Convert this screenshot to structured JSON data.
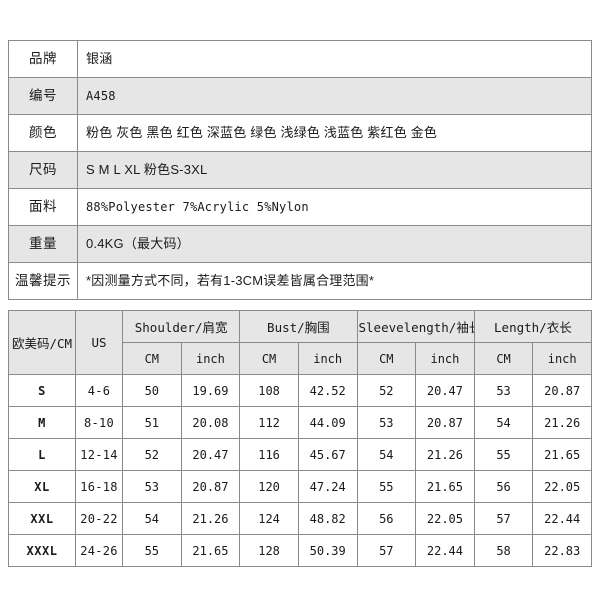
{
  "product_info": {
    "rows": [
      {
        "label": "品牌",
        "value": "银涵",
        "shaded": false,
        "mono": false
      },
      {
        "label": "编号",
        "value": "A458",
        "shaded": true,
        "mono": true
      },
      {
        "label": "颜色",
        "value": "粉色 灰色 黑色 红色 深蓝色 绿色 浅绿色 浅蓝色 紫红色 金色",
        "shaded": false,
        "mono": false
      },
      {
        "label": "尺码",
        "value": "S M L XL  粉色S-3XL",
        "shaded": true,
        "mono": false
      },
      {
        "label": "面料",
        "value": "88%Polyester  7%Acrylic  5%Nylon",
        "shaded": false,
        "mono": true
      },
      {
        "label": "重量",
        "value": "0.4KG（最大码）",
        "shaded": true,
        "mono": false
      },
      {
        "label": "温馨提示",
        "value": "*因测量方式不同，若有1-3CM误差皆属合理范围*",
        "shaded": false,
        "mono": false
      }
    ]
  },
  "size_chart": {
    "header_groups": [
      {
        "label": "欧美码/CM",
        "span": 1,
        "rowspan": 2
      },
      {
        "label": "US",
        "span": 1,
        "rowspan": 2
      },
      {
        "label": "Shoulder/肩宽",
        "span": 2,
        "rowspan": 1
      },
      {
        "label": "Bust/胸围",
        "span": 2,
        "rowspan": 1
      },
      {
        "label": "Sleevelength/袖长",
        "span": 2,
        "rowspan": 1
      },
      {
        "label": "Length/衣长",
        "span": 2,
        "rowspan": 1
      }
    ],
    "header_units": [
      "CM",
      "inch",
      "CM",
      "inch",
      "CM",
      "inch",
      "CM",
      "inch"
    ],
    "rows": [
      {
        "size": "S",
        "us": "4-6",
        "shoulder_cm": "50",
        "shoulder_inch": "19.69",
        "bust_cm": "108",
        "bust_inch": "42.52",
        "sleeve_cm": "52",
        "sleeve_inch": "20.47",
        "length_cm": "53",
        "length_inch": "20.87"
      },
      {
        "size": "M",
        "us": "8-10",
        "shoulder_cm": "51",
        "shoulder_inch": "20.08",
        "bust_cm": "112",
        "bust_inch": "44.09",
        "sleeve_cm": "53",
        "sleeve_inch": "20.87",
        "length_cm": "54",
        "length_inch": "21.26"
      },
      {
        "size": "L",
        "us": "12-14",
        "shoulder_cm": "52",
        "shoulder_inch": "20.47",
        "bust_cm": "116",
        "bust_inch": "45.67",
        "sleeve_cm": "54",
        "sleeve_inch": "21.26",
        "length_cm": "55",
        "length_inch": "21.65"
      },
      {
        "size": "XL",
        "us": "16-18",
        "shoulder_cm": "53",
        "shoulder_inch": "20.87",
        "bust_cm": "120",
        "bust_inch": "47.24",
        "sleeve_cm": "55",
        "sleeve_inch": "21.65",
        "length_cm": "56",
        "length_inch": "22.05"
      },
      {
        "size": "XXL",
        "us": "20-22",
        "shoulder_cm": "54",
        "shoulder_inch": "21.26",
        "bust_cm": "124",
        "bust_inch": "48.82",
        "sleeve_cm": "56",
        "sleeve_inch": "22.05",
        "length_cm": "57",
        "length_inch": "22.44"
      },
      {
        "size": "XXXL",
        "us": "24-26",
        "shoulder_cm": "55",
        "shoulder_inch": "21.65",
        "bust_cm": "128",
        "bust_inch": "50.39",
        "sleeve_cm": "57",
        "sleeve_inch": "22.44",
        "length_cm": "58",
        "length_inch": "22.83"
      }
    ]
  },
  "colors": {
    "background": "#ffffff",
    "shaded_row": "#e6e6e6",
    "border": "#8a8a8a",
    "text": "#1a1a1a"
  }
}
